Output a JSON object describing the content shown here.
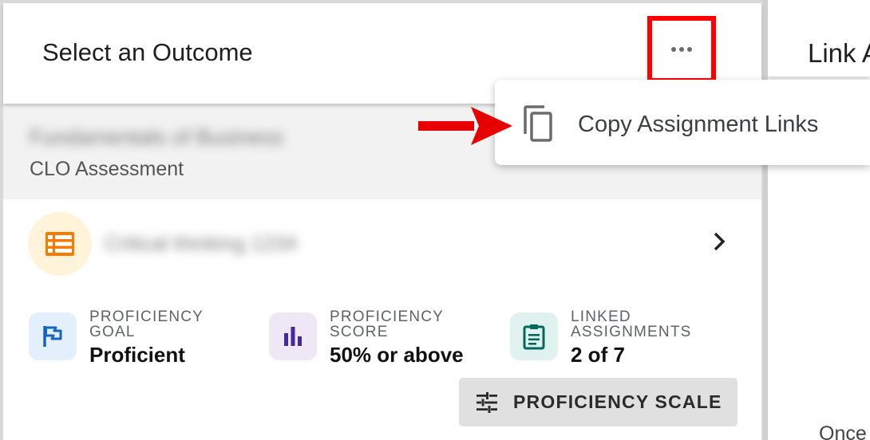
{
  "header": {
    "title": "Select an Outcome",
    "more_icon": "more-horizontal-icon"
  },
  "course": {
    "name": "Fundamentals of Business",
    "type": "CLO Assessment"
  },
  "outcome": {
    "name": "Critical thinking 1234",
    "icon": "list-icon",
    "icon_color": "#f57c00"
  },
  "metrics": [
    {
      "label": "Proficiency Goal",
      "value": "Proficient",
      "icon": "flag-icon",
      "color": "#1565c0",
      "bg": "#e3f0fc"
    },
    {
      "label": "Proficiency Score",
      "value": "50% or above",
      "icon": "bar-chart-icon",
      "color": "#4527a0",
      "bg": "#ede7f6"
    },
    {
      "label": "Linked Assignments",
      "value": "2 of 7",
      "icon": "clipboard-icon",
      "color": "#00695c",
      "bg": "#e0f2ef"
    }
  ],
  "scale_button": {
    "label": "PROFICIENCY SCALE",
    "icon": "tune-icon"
  },
  "menu": {
    "items": [
      {
        "label": "Copy Assignment Links",
        "icon": "copy-icon"
      }
    ]
  },
  "right_panel": {
    "title": "Link A",
    "footer_text": "Once"
  },
  "annotation": {
    "highlight_color": "#ff0000",
    "arrow_color": "#e60000"
  }
}
